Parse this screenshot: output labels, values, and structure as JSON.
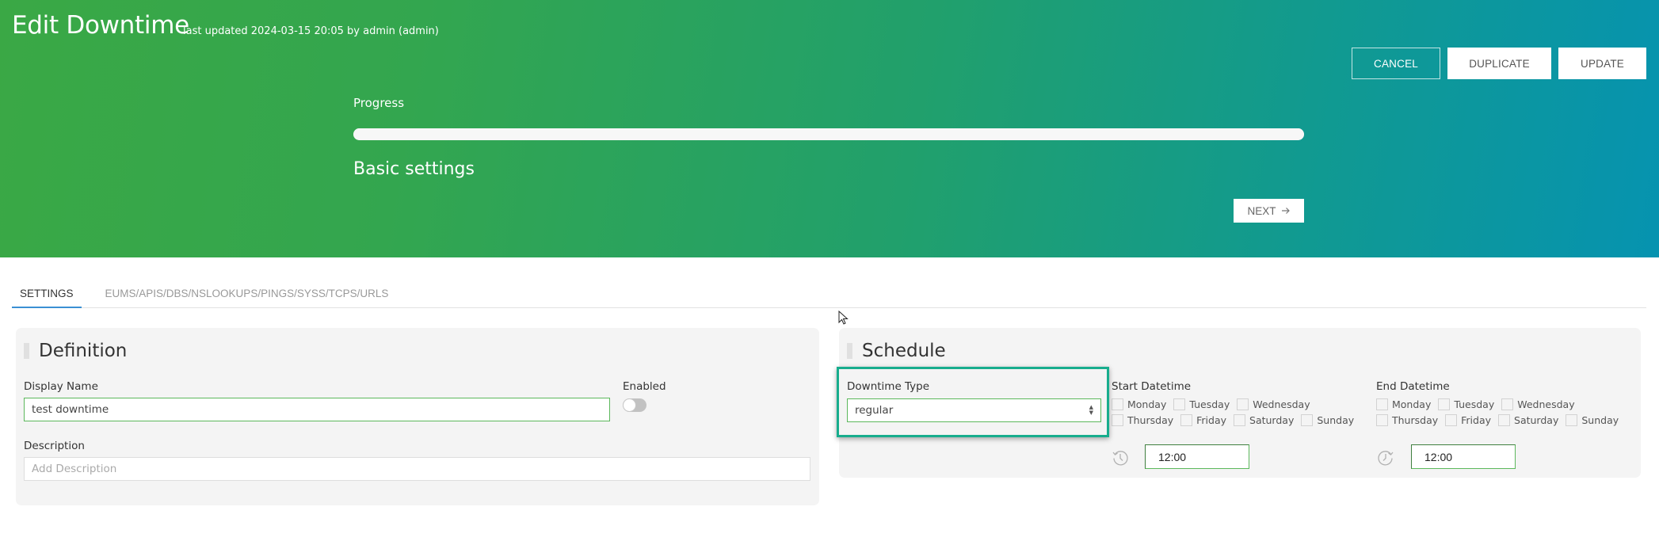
{
  "header": {
    "title": "Edit Downtime",
    "last_updated": "last updated 2024-03-15 20:05 by admin (admin)",
    "buttons": {
      "cancel": "CANCEL",
      "duplicate": "DUPLICATE",
      "update": "UPDATE"
    },
    "progress": {
      "label": "Progress",
      "value_percent": 100
    },
    "step_title": "Basic settings",
    "next_button": "NEXT",
    "next_icon": "arrow-right-icon",
    "colors": {
      "gradient_start": "#3aa845",
      "gradient_end": "#0693b0"
    }
  },
  "tabs": [
    {
      "label": "SETTINGS",
      "active": true
    },
    {
      "label": "EUMS/APIS/DBS/NSLOOKUPS/PINGS/SYSS/TCPS/URLS",
      "active": false
    }
  ],
  "definition": {
    "title": "Definition",
    "display_name": {
      "label": "Display Name",
      "value": "test downtime"
    },
    "enabled": {
      "label": "Enabled",
      "value": false
    },
    "description": {
      "label": "Description",
      "value": "",
      "placeholder": "Add Description"
    }
  },
  "schedule": {
    "title": "Schedule",
    "downtime_type": {
      "label": "Downtime Type",
      "value": "regular"
    },
    "start": {
      "label": "Start Datetime",
      "days_row1": [
        "Monday",
        "Tuesday",
        "Wednesday"
      ],
      "days_row2": [
        "Thursday",
        "Friday",
        "Saturday",
        "Sunday"
      ],
      "time": "12:00",
      "icon": "history-clock-icon"
    },
    "end": {
      "label": "End Datetime",
      "days_row1": [
        "Monday",
        "Tuesday",
        "Wednesday"
      ],
      "days_row2": [
        "Thursday",
        "Friday",
        "Saturday",
        "Sunday"
      ],
      "time": "12:00",
      "icon": "restore-clock-icon"
    }
  }
}
